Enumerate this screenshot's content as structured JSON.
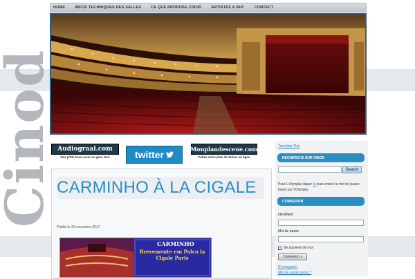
{
  "nav": {
    "items": [
      "HOME",
      "INFOS TECHNIQUES DES SALLES",
      "CE QUE PROPOSE CINOD",
      "ARTISTES A 360°",
      "CONTACT"
    ]
  },
  "branding": {
    "side_word": "Cinod"
  },
  "logos": {
    "audiograal": {
      "title": "Audiograal.com",
      "subtitle": "Des p'tits trucs pour un gros Son"
    },
    "twitter": {
      "title": "twitter"
    },
    "monplan": {
      "title": "Monplandescene.com",
      "subtitle": "Faites votre plan de Scène en ligne"
    }
  },
  "post": {
    "title": "CARMINHO À LA CIGALE",
    "date": "Publié le 16 novembre 2017",
    "image_caption_title": "CARMINHO",
    "image_caption_text": "Brevemente em Palco la Cigale Paris"
  },
  "sidebar": {
    "translate_link": "Translate This",
    "search_heading": "RECHERCHE SUR CINOD",
    "search_button": "Search",
    "search_placeholder": "",
    "olympia_text_before": "Pour L'olympia cliquer ",
    "olympia_link": "ici",
    "olympia_text_after": " puis entrez le mot de passe fourni par l'Olympia.",
    "login_heading": "CONNEXION",
    "username_label": "Identifiant",
    "password_label": "Mot de passe",
    "remember_label": "Se souvenir de moi",
    "login_button": "Connexion »",
    "register_link": "S'enregistrer",
    "lost_password_link": "Mot de passe perdu ?"
  },
  "colors": {
    "accent": "#2a8ec3",
    "nav_bg": "#cfd4d8",
    "hero_border": "#2d5f85"
  }
}
